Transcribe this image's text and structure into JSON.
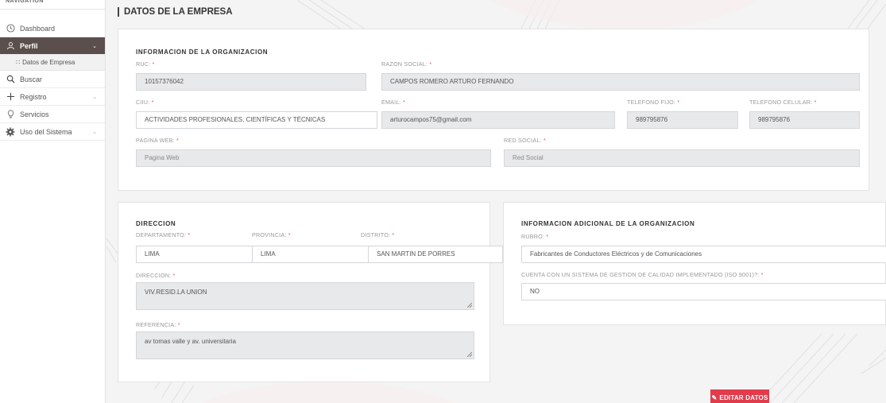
{
  "nav": {
    "header": "NAVIGATION",
    "items": [
      {
        "label": "Dashboard",
        "icon": "clock-icon"
      },
      {
        "label": "Perfil",
        "icon": "user-icon",
        "active": true
      },
      {
        "label": "Buscar",
        "icon": "search-icon"
      },
      {
        "label": "Registro",
        "icon": "plus-icon"
      },
      {
        "label": "Servicios",
        "icon": "lightbulb-icon"
      },
      {
        "label": "Uso del Sistema",
        "icon": "gear-icon"
      }
    ],
    "sub_item": "Datos de Empresa"
  },
  "page": {
    "title": "DATOS DE LA EMPRESA"
  },
  "organizacion": {
    "title": "INFORMACION DE LA ORGANIZACION",
    "ruc": {
      "label": "RUC:",
      "value": "10157376042"
    },
    "razon_social": {
      "label": "RAZON SOCIAL:",
      "value": "CAMPOS ROMERO ARTURO FERNANDO"
    },
    "ciiu": {
      "label": "CIIU:",
      "value": "ACTIVIDADES PROFESIONALES, CIENTÍFICAS Y TÉCNICAS"
    },
    "email": {
      "label": "EMAIL:",
      "value": "arturocampos75@gmail.com"
    },
    "telefono_fijo": {
      "label": "TELEFONO FIJO:",
      "value": "989795876"
    },
    "telefono_celular": {
      "label": "TELEFONO CELULAR:",
      "value": "989795876"
    },
    "pagina_web": {
      "label": "PAGINA WEB:",
      "placeholder": "Pagina Web"
    },
    "red_social": {
      "label": "RED SOCIAL:",
      "placeholder": "Red Social"
    }
  },
  "direccion": {
    "title": "DIRECCION",
    "departamento": {
      "label": "DEPARTAMENTO:",
      "value": "LIMA"
    },
    "provincia": {
      "label": "PROVINCIA:",
      "value": "LIMA"
    },
    "distrito": {
      "label": "DISTRITO:",
      "value": "SAN MARTIN DE PORRES"
    },
    "direccion": {
      "label": "DIRECCION:",
      "value": "VIV.RESID.LA UNION"
    },
    "referencia": {
      "label": "REFERENCIA:",
      "value": "av tomas valle y av. universitaria"
    }
  },
  "adicional": {
    "title": "INFORMACION ADICIONAL DE LA ORGANIZACION",
    "rubro": {
      "label": "RUBRO:",
      "value": "Fabricantes de Conductores Eléctricos y de Comunicaciones"
    },
    "calidad": {
      "label": "CUENTA CON UN SISTEMA DE GESTION DE CALIDAD IMPLEMENTADO (ISO 9001)?:",
      "value": "NO"
    }
  },
  "required_mark": "*",
  "actions": {
    "edit_label": "EDITAR DATOS"
  },
  "colors": {
    "sidebar_active": "#5b4f4d",
    "edit_button": "#e23b4b",
    "required": "#e05567"
  }
}
